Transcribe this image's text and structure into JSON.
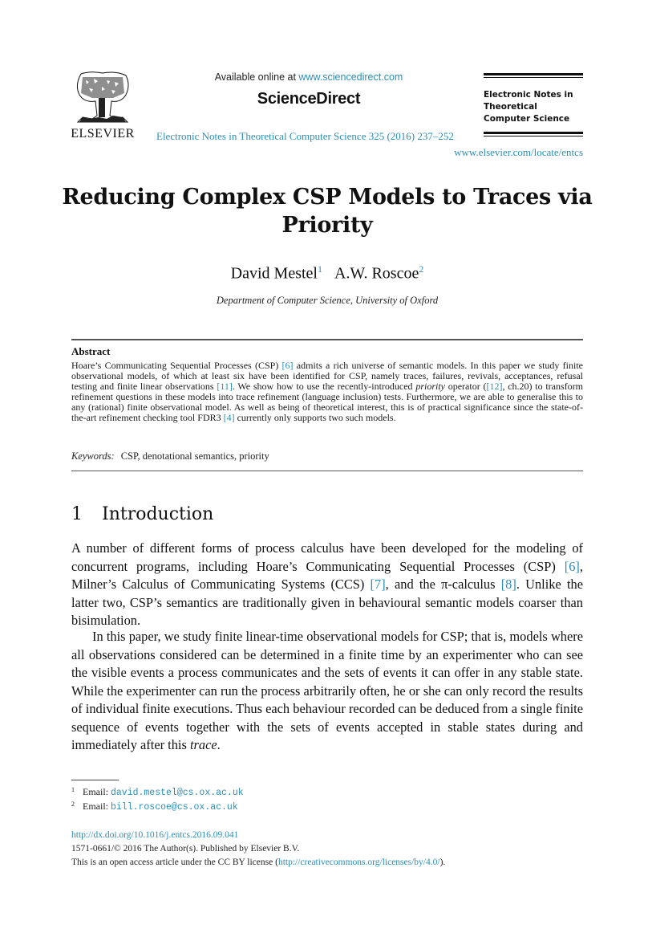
{
  "header": {
    "publisher_logo_text": "ELSEVIER",
    "available_online_prefix": "Available online at ",
    "available_online_link": "www.sciencedirect.com",
    "sciencedirect_brand": "ScienceDirect",
    "journal_citation": "Electronic Notes in Theoretical Computer Science 325 (2016) 237–252",
    "journal_box_title": "Electronic Notes in Theoretical Computer Science",
    "journal_url": "www.elsevier.com/locate/entcs"
  },
  "paper": {
    "title": "Reducing Complex CSP Models to Traces via Priority",
    "authors": [
      {
        "name": "David Mestel",
        "mark": "1"
      },
      {
        "name": "A.W. Roscoe",
        "mark": "2"
      }
    ],
    "affiliation": "Department of Computer Science, University of Oxford"
  },
  "abstract": {
    "heading": "Abstract",
    "segments": [
      {
        "t": "Hoare’s Communicating Sequential Processes (CSP) "
      },
      {
        "t": "[6]",
        "link": true
      },
      {
        "t": " admits a rich universe of semantic models. In this paper we study finite observational models, of which at least six have been identified for CSP, namely traces, failures, revivals, acceptances, refusal testing and finite linear observations "
      },
      {
        "t": "[11]",
        "link": true
      },
      {
        "t": ". We show how to use the recently-introduced "
      },
      {
        "t": "priority",
        "italic": true
      },
      {
        "t": " operator ("
      },
      {
        "t": "[12]",
        "link": true
      },
      {
        "t": ", ch.20) to transform refinement questions in these models into trace refinement (language inclusion) tests. Furthermore, we are able to generalise this to any (rational) finite observational model. As well as being of theoretical interest, this is of practical significance since the state-of-the-art refinement checking tool FDR3 "
      },
      {
        "t": "[4]",
        "link": true
      },
      {
        "t": " currently only supports two such models."
      }
    ],
    "keywords_label": "Keywords:",
    "keywords": "CSP, denotational semantics, priority"
  },
  "section": {
    "number": "1",
    "title": "Introduction",
    "paragraph1": [
      {
        "t": "A number of different forms of process calculus have been developed for the modeling of concurrent programs, including Hoare’s Communicating Sequential Processes (CSP) "
      },
      {
        "t": "[6]",
        "link": true
      },
      {
        "t": ", Milner’s Calculus of Communicating Systems (CCS) "
      },
      {
        "t": "[7]",
        "link": true
      },
      {
        "t": ", and the π-calculus "
      },
      {
        "t": "[8]",
        "link": true
      },
      {
        "t": ". Unlike the latter two, CSP’s semantics are traditionally given in behavioural semantic models coarser than bisimulation."
      }
    ],
    "paragraph2": [
      {
        "t": "In this paper, we study finite linear-time observational models for CSP; that is, models where all observations considered can be determined in a finite time by an experimenter who can see the visible events a process communicates and the sets of events it can offer in any stable state. While the experimenter can run the process arbitrarily often, he or she can only record the results of individual finite executions. Thus each behaviour recorded can be deduced from a single finite sequence of events together with the sets of events accepted in stable states during and immediately after this "
      },
      {
        "t": "trace",
        "italic": true
      },
      {
        "t": "."
      }
    ]
  },
  "footnotes": [
    {
      "mark": "1",
      "label": "Email:",
      "email": "david.mestel@cs.ox.ac.uk"
    },
    {
      "mark": "2",
      "label": "Email:",
      "email": "bill.roscoe@cs.ox.ac.uk"
    }
  ],
  "footer": {
    "doi": "http://dx.doi.org/10.1016/j.entcs.2016.09.041",
    "copyright": "1571-0661/© 2016 The Author(s). Published by Elsevier B.V.",
    "license_prefix": "This is an open access article under the CC BY license (",
    "license_link": "http://creativecommons.org/licenses/by/4.0/",
    "license_suffix": ")."
  },
  "colors": {
    "link": "#2b8fb5",
    "text": "#111111"
  }
}
